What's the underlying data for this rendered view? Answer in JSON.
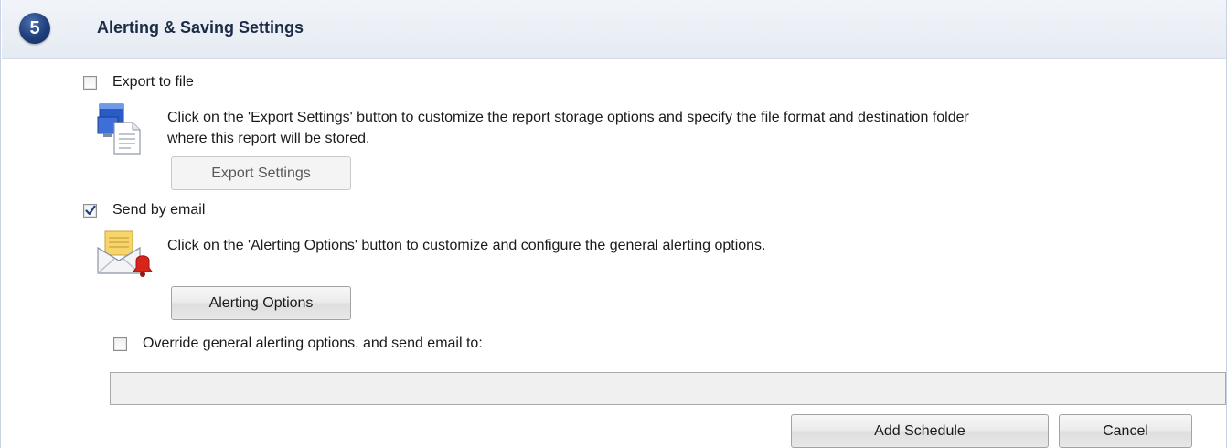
{
  "section": {
    "step_number": "5",
    "title": "Alerting & Saving Settings"
  },
  "export": {
    "checkbox_label": "Export to file",
    "checked": false,
    "description_line1": "Click on the 'Export Settings' button to customize the report storage options and specify the file format and destination folder",
    "description_line2": "where this report will be stored.",
    "button_label": "Export Settings",
    "button_enabled": false,
    "icon": "export-document-icon"
  },
  "email": {
    "checkbox_label": "Send by email",
    "checked": true,
    "description": "Click on the 'Alerting Options' button to customize and configure the general alerting options.",
    "button_label": "Alerting Options",
    "icon": "email-alert-icon"
  },
  "override": {
    "checkbox_label": "Override general alerting options, and send email to:",
    "checked": false,
    "email_value": "",
    "email_placeholder": ""
  },
  "footer": {
    "add_label": "Add Schedule",
    "cancel_label": "Cancel"
  },
  "colors": {
    "header_bg": "#e6ebf3",
    "badge": "#1f3f7a",
    "check": "#1d3f8a"
  }
}
